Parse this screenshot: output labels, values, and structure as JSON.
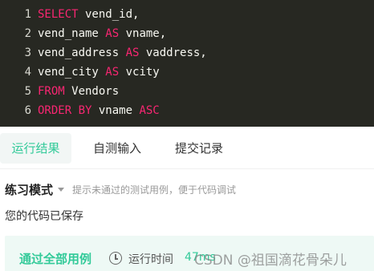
{
  "editor": {
    "lines": [
      {
        "num": "1",
        "tokens": [
          {
            "t": "SELECT",
            "kw": true
          },
          {
            "t": " vend_id,",
            "kw": false
          }
        ]
      },
      {
        "num": "2",
        "tokens": [
          {
            "t": "vend_name ",
            "kw": false
          },
          {
            "t": "AS",
            "kw": true
          },
          {
            "t": " vname,",
            "kw": false
          }
        ]
      },
      {
        "num": "3",
        "tokens": [
          {
            "t": "vend_address ",
            "kw": false
          },
          {
            "t": "AS",
            "kw": true
          },
          {
            "t": " vaddress,",
            "kw": false
          }
        ]
      },
      {
        "num": "4",
        "tokens": [
          {
            "t": "vend_city ",
            "kw": false
          },
          {
            "t": "AS",
            "kw": true
          },
          {
            "t": " vcity",
            "kw": false
          }
        ]
      },
      {
        "num": "5",
        "tokens": [
          {
            "t": "FROM",
            "kw": true
          },
          {
            "t": " Vendors",
            "kw": false
          }
        ]
      },
      {
        "num": "6",
        "tokens": [
          {
            "t": "ORDER BY",
            "kw": true
          },
          {
            "t": " vname ",
            "kw": false
          },
          {
            "t": "ASC",
            "kw": true
          }
        ]
      }
    ]
  },
  "tabs": [
    {
      "label": "运行结果",
      "active": true
    },
    {
      "label": "自测输入",
      "active": false
    },
    {
      "label": "提交记录",
      "active": false
    }
  ],
  "mode": {
    "title": "练习模式",
    "hint": "提示未通过的测试用例，便于代码调试"
  },
  "status": {
    "saved": "您的代码已保存"
  },
  "result": {
    "pass_label": "通过全部用例",
    "runtime_label": "运行时间",
    "runtime_value": "47ms"
  },
  "watermark": "CSDN @祖国滴花骨朵儿",
  "colors": {
    "accent": "#32ca99",
    "keyword": "#f92672",
    "editor_bg": "#272822"
  }
}
